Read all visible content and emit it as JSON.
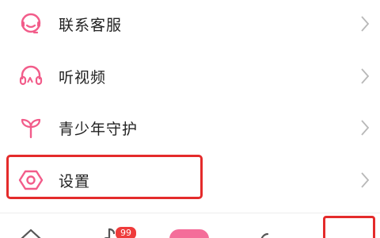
{
  "menu": {
    "items": [
      {
        "label": "联系客服",
        "icon": "headset-icon"
      },
      {
        "label": "听视频",
        "icon": "headphones-icon"
      },
      {
        "label": "青少年守护",
        "icon": "sprout-icon"
      },
      {
        "label": "设置",
        "icon": "hexagon-settings-icon"
      }
    ]
  },
  "tabbar": {
    "badge": "99",
    "icons": [
      "home-icon",
      "music-icon",
      "center-icon",
      "mine-icon"
    ]
  },
  "colors": {
    "accent": "#f25c8a",
    "highlight": "#e42b2b",
    "chevron": "#b8b8b8",
    "text": "#222222"
  }
}
